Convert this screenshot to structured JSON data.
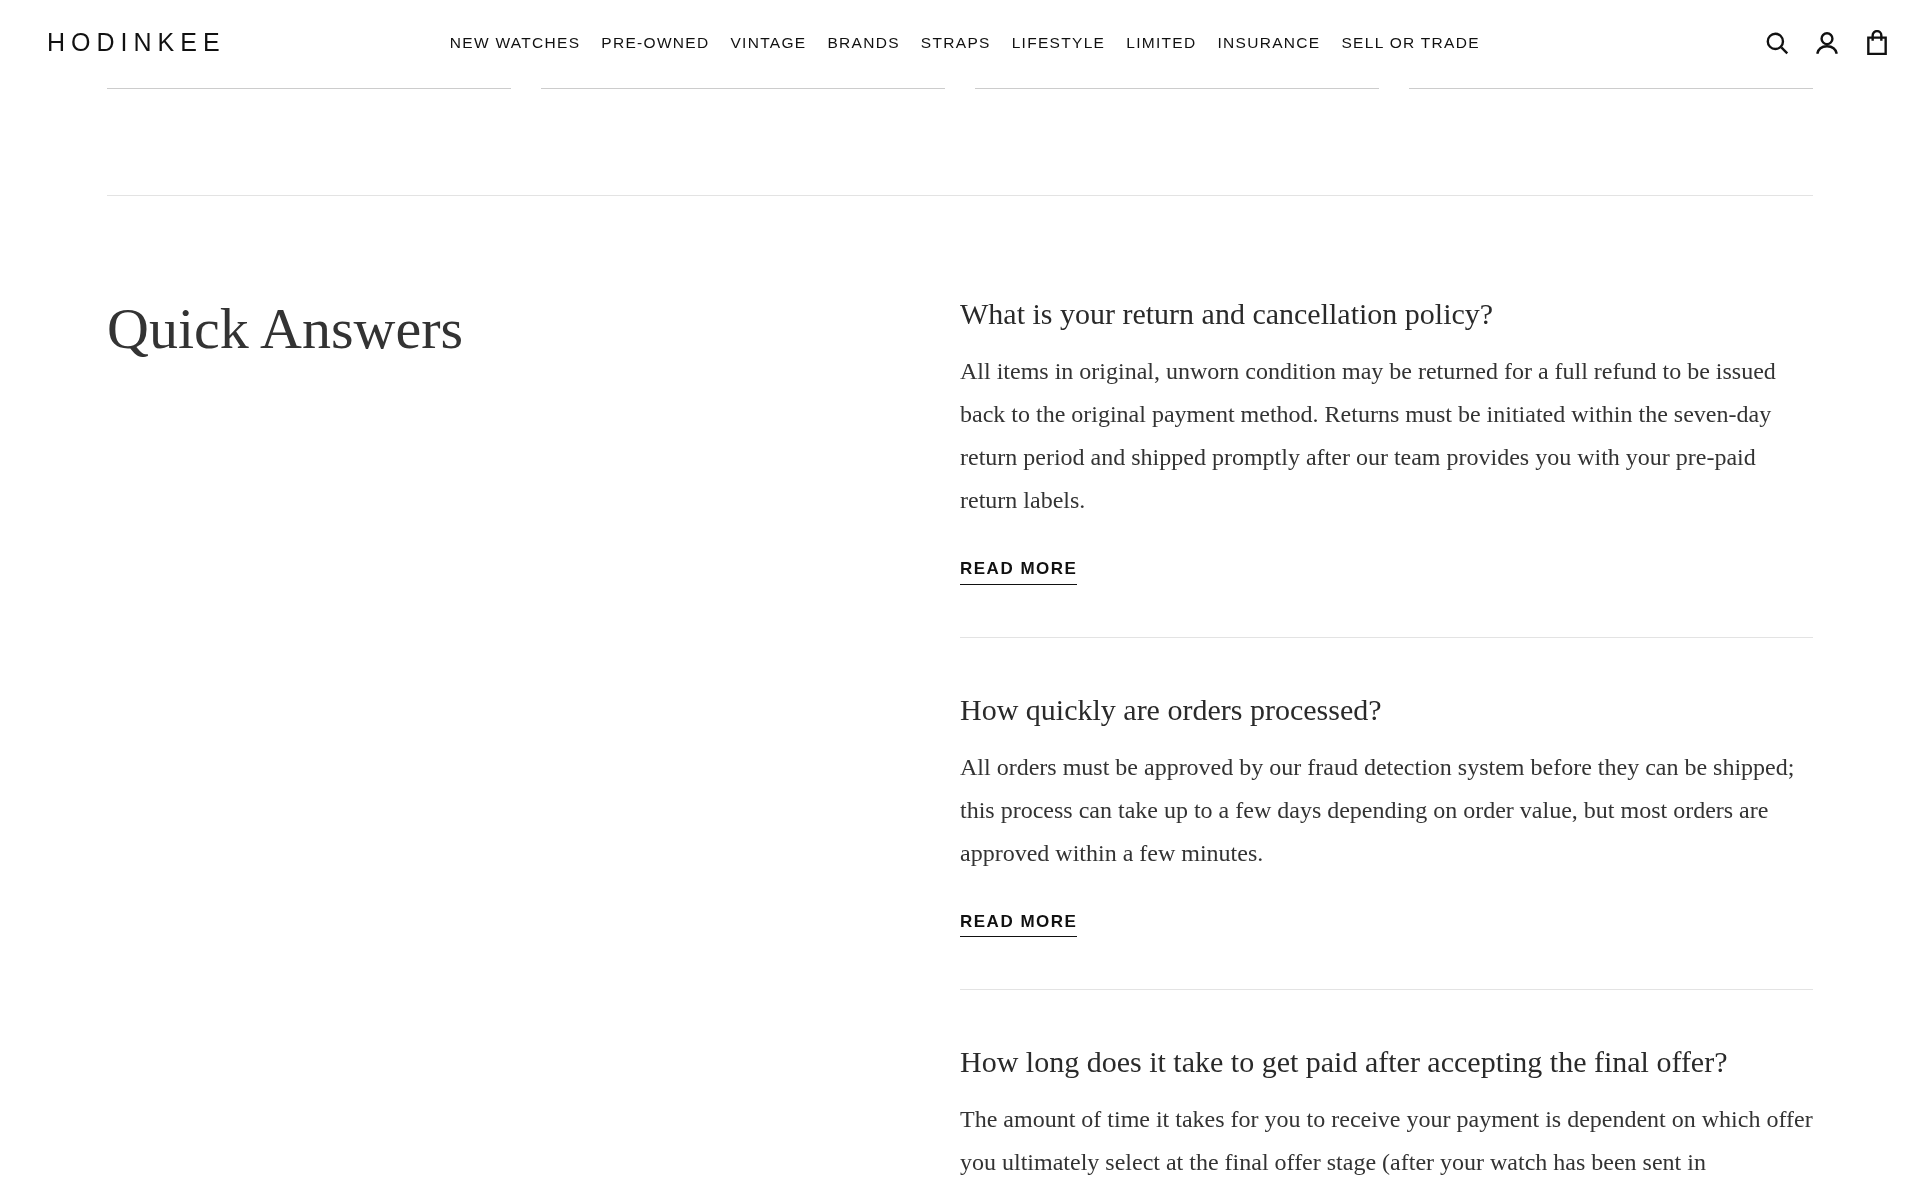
{
  "header": {
    "logo": "HODINKEE",
    "nav": [
      "NEW WATCHES",
      "PRE-OWNED",
      "VINTAGE",
      "BRANDS",
      "STRAPS",
      "LIFESTYLE",
      "LIMITED",
      "INSURANCE",
      "SELL OR TRADE"
    ]
  },
  "section": {
    "title": "Quick Answers",
    "faqs": [
      {
        "question": "What is your return and cancellation policy?",
        "answer": "All items in original, unworn condition may be returned for a full refund to be issued back to the original payment method. Returns must be initiated within the seven-day return period and shipped promptly after our team provides you with your pre-paid return labels.",
        "link": "READ MORE"
      },
      {
        "question": "How quickly are orders processed?",
        "answer": "All orders must be approved by our fraud detection system before they can be shipped; this process can take up to a few days depending on order value, but most orders are approved within a few minutes.",
        "link": "READ MORE"
      },
      {
        "question": "How long does it take to get paid after accepting the final offer?",
        "answer": "The amount of time it takes for you to receive your payment is dependent on which offer you ultimately select at the final offer stage (after your watch has been sent in"
      }
    ]
  }
}
